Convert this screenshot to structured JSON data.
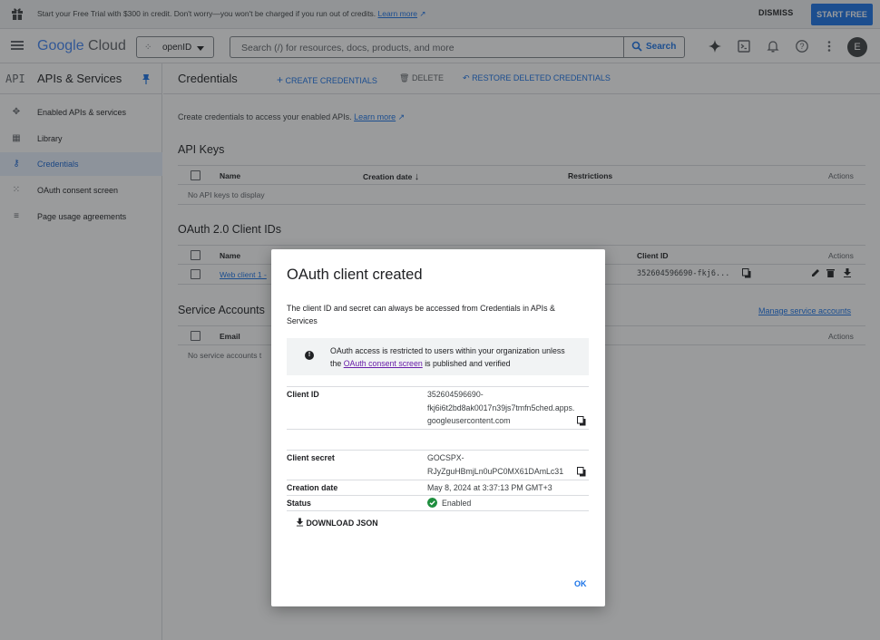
{
  "banner": {
    "message": "Start your Free Trial with $300 in credit. Don't worry—you won't be charged if you run out of credits.",
    "learn_more": "Learn more",
    "dismiss": "DISMISS",
    "start_free": "START FREE"
  },
  "header": {
    "logo_google": "Google",
    "logo_cloud": "Cloud",
    "project": "openID",
    "search_placeholder": "Search (/) for resources, docs, products, and more",
    "search_button": "Search",
    "avatar_letter": "E"
  },
  "sidebar": {
    "api_badge": "API",
    "title": "APIs & Services",
    "items": [
      {
        "label": "Enabled APIs & services"
      },
      {
        "label": "Library"
      },
      {
        "label": "Credentials"
      },
      {
        "label": "OAuth consent screen"
      },
      {
        "label": "Page usage agreements"
      }
    ]
  },
  "main": {
    "title": "Credentials",
    "create": "CREATE CREDENTIALS",
    "delete": "DELETE",
    "restore": "RESTORE DELETED CREDENTIALS",
    "intro": "Create credentials to access your enabled APIs.",
    "intro_link": "Learn more",
    "api_keys": {
      "heading": "API Keys",
      "columns": [
        "Name",
        "Creation date",
        "Restrictions",
        "Actions"
      ],
      "empty": "No API keys to display"
    },
    "oauth": {
      "heading": "OAuth 2.0 Client IDs",
      "columns": [
        "Name",
        "Client ID",
        "Actions"
      ],
      "row_name": "Web client 1 -",
      "row_client_id": "352604596690-fkj6..."
    },
    "service_accounts": {
      "heading": "Service Accounts",
      "manage": "Manage service accounts",
      "columns": [
        "Email",
        "Actions"
      ],
      "empty": "No service accounts t"
    }
  },
  "dialog": {
    "title": "OAuth client created",
    "description": "The client ID and secret can always be accessed from Credentials in APIs & Services",
    "info_before": "OAuth access is restricted to users within your organization unless the",
    "info_link": "OAuth consent screen",
    "info_after": "is published and verified",
    "client_id_label": "Client ID",
    "client_id_lines": [
      "352604596690-",
      "fkj6i6t2bd8ak0017n39js7tmfn5ched.apps.",
      "googleusercontent.com"
    ],
    "client_secret_label": "Client secret",
    "client_secret_lines": [
      "GOCSPX-",
      "RJyZguHBmjLn0uPC0MX61DAmLc31"
    ],
    "creation_date_label": "Creation date",
    "creation_date": "May 8, 2024 at 3:37:13 PM GMT+3",
    "status_label": "Status",
    "status": "Enabled",
    "download_json": "DOWNLOAD JSON",
    "ok": "OK"
  },
  "colors": {
    "accent": "#1a73e8",
    "status_green": "#1e8e3e",
    "link_visited": "#681da8"
  }
}
